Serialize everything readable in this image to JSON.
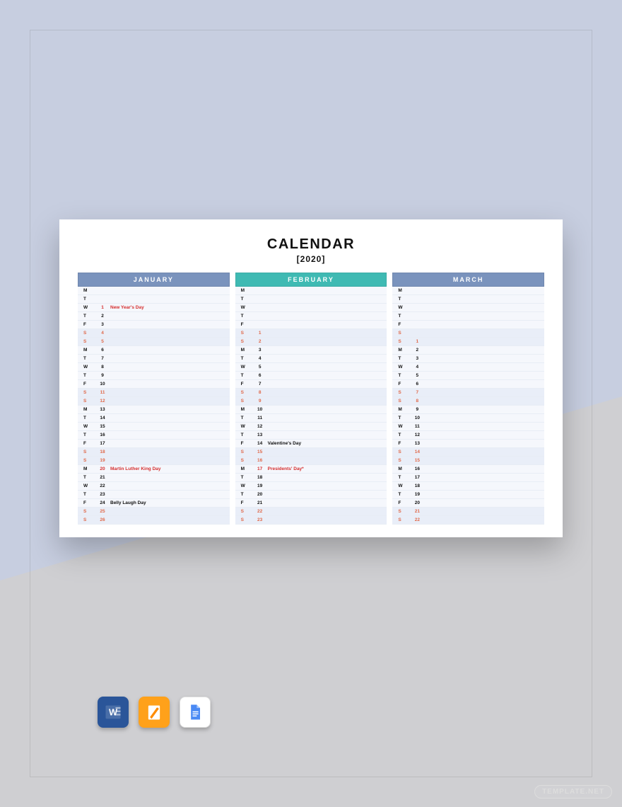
{
  "header": {
    "title": "CALENDAR",
    "subtitle": "[2020]"
  },
  "months": [
    {
      "name": "JANUARY",
      "header_color": "#7a93bd",
      "rows": [
        {
          "day": "M",
          "num": "",
          "event": "",
          "weekend": false,
          "holiday": false
        },
        {
          "day": "T",
          "num": "",
          "event": "",
          "weekend": false,
          "holiday": false
        },
        {
          "day": "W",
          "num": "1",
          "event": "New Year's Day",
          "weekend": false,
          "holiday": true
        },
        {
          "day": "T",
          "num": "2",
          "event": "",
          "weekend": false,
          "holiday": false
        },
        {
          "day": "F",
          "num": "3",
          "event": "",
          "weekend": false,
          "holiday": false
        },
        {
          "day": "S",
          "num": "4",
          "event": "",
          "weekend": true,
          "holiday": false
        },
        {
          "day": "S",
          "num": "5",
          "event": "",
          "weekend": true,
          "holiday": false
        },
        {
          "day": "M",
          "num": "6",
          "event": "",
          "weekend": false,
          "holiday": false
        },
        {
          "day": "T",
          "num": "7",
          "event": "",
          "weekend": false,
          "holiday": false
        },
        {
          "day": "W",
          "num": "8",
          "event": "",
          "weekend": false,
          "holiday": false
        },
        {
          "day": "T",
          "num": "9",
          "event": "",
          "weekend": false,
          "holiday": false
        },
        {
          "day": "F",
          "num": "10",
          "event": "",
          "weekend": false,
          "holiday": false
        },
        {
          "day": "S",
          "num": "11",
          "event": "",
          "weekend": true,
          "holiday": false
        },
        {
          "day": "S",
          "num": "12",
          "event": "",
          "weekend": true,
          "holiday": false
        },
        {
          "day": "M",
          "num": "13",
          "event": "",
          "weekend": false,
          "holiday": false
        },
        {
          "day": "T",
          "num": "14",
          "event": "",
          "weekend": false,
          "holiday": false
        },
        {
          "day": "W",
          "num": "15",
          "event": "",
          "weekend": false,
          "holiday": false
        },
        {
          "day": "T",
          "num": "16",
          "event": "",
          "weekend": false,
          "holiday": false
        },
        {
          "day": "F",
          "num": "17",
          "event": "",
          "weekend": false,
          "holiday": false
        },
        {
          "day": "S",
          "num": "18",
          "event": "",
          "weekend": true,
          "holiday": false
        },
        {
          "day": "S",
          "num": "19",
          "event": "",
          "weekend": true,
          "holiday": false
        },
        {
          "day": "M",
          "num": "20",
          "event": "Martin Luther King Day",
          "weekend": false,
          "holiday": true
        },
        {
          "day": "T",
          "num": "21",
          "event": "",
          "weekend": false,
          "holiday": false
        },
        {
          "day": "W",
          "num": "22",
          "event": "",
          "weekend": false,
          "holiday": false
        },
        {
          "day": "T",
          "num": "23",
          "event": "",
          "weekend": false,
          "holiday": false
        },
        {
          "day": "F",
          "num": "24",
          "event": "Belly Laugh Day",
          "weekend": false,
          "holiday": false
        },
        {
          "day": "S",
          "num": "25",
          "event": "",
          "weekend": true,
          "holiday": false
        },
        {
          "day": "S",
          "num": "26",
          "event": "",
          "weekend": true,
          "holiday": false
        }
      ]
    },
    {
      "name": "FEBRUARY",
      "header_color": "#3fbab3",
      "rows": [
        {
          "day": "M",
          "num": "",
          "event": "",
          "weekend": false,
          "holiday": false
        },
        {
          "day": "T",
          "num": "",
          "event": "",
          "weekend": false,
          "holiday": false
        },
        {
          "day": "W",
          "num": "",
          "event": "",
          "weekend": false,
          "holiday": false
        },
        {
          "day": "T",
          "num": "",
          "event": "",
          "weekend": false,
          "holiday": false
        },
        {
          "day": "F",
          "num": "",
          "event": "",
          "weekend": false,
          "holiday": false
        },
        {
          "day": "S",
          "num": "1",
          "event": "",
          "weekend": true,
          "holiday": false
        },
        {
          "day": "S",
          "num": "2",
          "event": "",
          "weekend": true,
          "holiday": false
        },
        {
          "day": "M",
          "num": "3",
          "event": "",
          "weekend": false,
          "holiday": false
        },
        {
          "day": "T",
          "num": "4",
          "event": "",
          "weekend": false,
          "holiday": false
        },
        {
          "day": "W",
          "num": "5",
          "event": "",
          "weekend": false,
          "holiday": false
        },
        {
          "day": "T",
          "num": "6",
          "event": "",
          "weekend": false,
          "holiday": false
        },
        {
          "day": "F",
          "num": "7",
          "event": "",
          "weekend": false,
          "holiday": false
        },
        {
          "day": "S",
          "num": "8",
          "event": "",
          "weekend": true,
          "holiday": false
        },
        {
          "day": "S",
          "num": "9",
          "event": "",
          "weekend": true,
          "holiday": false
        },
        {
          "day": "M",
          "num": "10",
          "event": "",
          "weekend": false,
          "holiday": false
        },
        {
          "day": "T",
          "num": "11",
          "event": "",
          "weekend": false,
          "holiday": false
        },
        {
          "day": "W",
          "num": "12",
          "event": "",
          "weekend": false,
          "holiday": false
        },
        {
          "day": "T",
          "num": "13",
          "event": "",
          "weekend": false,
          "holiday": false
        },
        {
          "day": "F",
          "num": "14",
          "event": "Valentine's Day",
          "weekend": false,
          "holiday": false
        },
        {
          "day": "S",
          "num": "15",
          "event": "",
          "weekend": true,
          "holiday": false
        },
        {
          "day": "S",
          "num": "16",
          "event": "",
          "weekend": true,
          "holiday": false
        },
        {
          "day": "M",
          "num": "17",
          "event": "Presidents' Day*",
          "weekend": false,
          "holiday": true
        },
        {
          "day": "T",
          "num": "18",
          "event": "",
          "weekend": false,
          "holiday": false
        },
        {
          "day": "W",
          "num": "19",
          "event": "",
          "weekend": false,
          "holiday": false
        },
        {
          "day": "T",
          "num": "20",
          "event": "",
          "weekend": false,
          "holiday": false
        },
        {
          "day": "F",
          "num": "21",
          "event": "",
          "weekend": false,
          "holiday": false
        },
        {
          "day": "S",
          "num": "22",
          "event": "",
          "weekend": true,
          "holiday": false
        },
        {
          "day": "S",
          "num": "23",
          "event": "",
          "weekend": true,
          "holiday": false
        }
      ]
    },
    {
      "name": "MARCH",
      "header_color": "#7a93bd",
      "rows": [
        {
          "day": "M",
          "num": "",
          "event": "",
          "weekend": false,
          "holiday": false
        },
        {
          "day": "T",
          "num": "",
          "event": "",
          "weekend": false,
          "holiday": false
        },
        {
          "day": "W",
          "num": "",
          "event": "",
          "weekend": false,
          "holiday": false
        },
        {
          "day": "T",
          "num": "",
          "event": "",
          "weekend": false,
          "holiday": false
        },
        {
          "day": "F",
          "num": "",
          "event": "",
          "weekend": false,
          "holiday": false
        },
        {
          "day": "S",
          "num": "",
          "event": "",
          "weekend": true,
          "holiday": false
        },
        {
          "day": "S",
          "num": "1",
          "event": "",
          "weekend": true,
          "holiday": false
        },
        {
          "day": "M",
          "num": "2",
          "event": "",
          "weekend": false,
          "holiday": false
        },
        {
          "day": "T",
          "num": "3",
          "event": "",
          "weekend": false,
          "holiday": false
        },
        {
          "day": "W",
          "num": "4",
          "event": "",
          "weekend": false,
          "holiday": false
        },
        {
          "day": "T",
          "num": "5",
          "event": "",
          "weekend": false,
          "holiday": false
        },
        {
          "day": "F",
          "num": "6",
          "event": "",
          "weekend": false,
          "holiday": false
        },
        {
          "day": "S",
          "num": "7",
          "event": "",
          "weekend": true,
          "holiday": false
        },
        {
          "day": "S",
          "num": "8",
          "event": "",
          "weekend": true,
          "holiday": false
        },
        {
          "day": "M",
          "num": "9",
          "event": "",
          "weekend": false,
          "holiday": false
        },
        {
          "day": "T",
          "num": "10",
          "event": "",
          "weekend": false,
          "holiday": false
        },
        {
          "day": "W",
          "num": "11",
          "event": "",
          "weekend": false,
          "holiday": false
        },
        {
          "day": "T",
          "num": "12",
          "event": "",
          "weekend": false,
          "holiday": false
        },
        {
          "day": "F",
          "num": "13",
          "event": "",
          "weekend": false,
          "holiday": false
        },
        {
          "day": "S",
          "num": "14",
          "event": "",
          "weekend": true,
          "holiday": false
        },
        {
          "day": "S",
          "num": "15",
          "event": "",
          "weekend": true,
          "holiday": false
        },
        {
          "day": "M",
          "num": "16",
          "event": "",
          "weekend": false,
          "holiday": false
        },
        {
          "day": "T",
          "num": "17",
          "event": "",
          "weekend": false,
          "holiday": false
        },
        {
          "day": "W",
          "num": "18",
          "event": "",
          "weekend": false,
          "holiday": false
        },
        {
          "day": "T",
          "num": "19",
          "event": "",
          "weekend": false,
          "holiday": false
        },
        {
          "day": "F",
          "num": "20",
          "event": "",
          "weekend": false,
          "holiday": false
        },
        {
          "day": "S",
          "num": "21",
          "event": "",
          "weekend": true,
          "holiday": false
        },
        {
          "day": "S",
          "num": "22",
          "event": "",
          "weekend": true,
          "holiday": false
        }
      ]
    }
  ],
  "watermark": "TEMPLATE.NET"
}
